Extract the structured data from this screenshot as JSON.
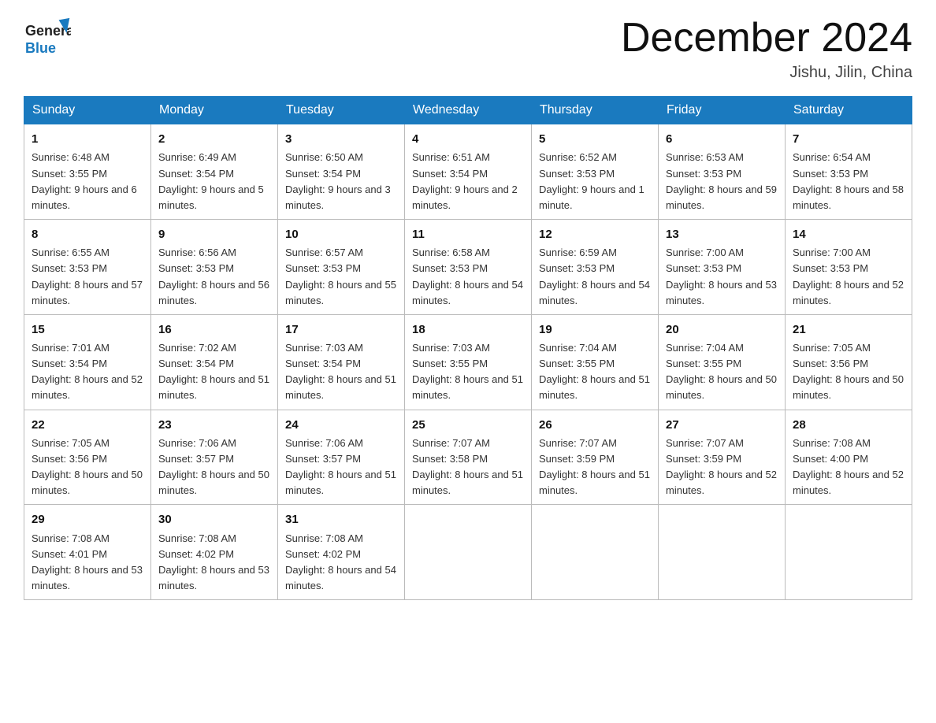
{
  "header": {
    "logo_text": "General Blue",
    "month_title": "December 2024",
    "location": "Jishu, Jilin, China"
  },
  "weekdays": [
    "Sunday",
    "Monday",
    "Tuesday",
    "Wednesday",
    "Thursday",
    "Friday",
    "Saturday"
  ],
  "weeks": [
    [
      {
        "day": "1",
        "sunrise": "6:48 AM",
        "sunset": "3:55 PM",
        "daylight": "9 hours and 6 minutes."
      },
      {
        "day": "2",
        "sunrise": "6:49 AM",
        "sunset": "3:54 PM",
        "daylight": "9 hours and 5 minutes."
      },
      {
        "day": "3",
        "sunrise": "6:50 AM",
        "sunset": "3:54 PM",
        "daylight": "9 hours and 3 minutes."
      },
      {
        "day": "4",
        "sunrise": "6:51 AM",
        "sunset": "3:54 PM",
        "daylight": "9 hours and 2 minutes."
      },
      {
        "day": "5",
        "sunrise": "6:52 AM",
        "sunset": "3:53 PM",
        "daylight": "9 hours and 1 minute."
      },
      {
        "day": "6",
        "sunrise": "6:53 AM",
        "sunset": "3:53 PM",
        "daylight": "8 hours and 59 minutes."
      },
      {
        "day": "7",
        "sunrise": "6:54 AM",
        "sunset": "3:53 PM",
        "daylight": "8 hours and 58 minutes."
      }
    ],
    [
      {
        "day": "8",
        "sunrise": "6:55 AM",
        "sunset": "3:53 PM",
        "daylight": "8 hours and 57 minutes."
      },
      {
        "day": "9",
        "sunrise": "6:56 AM",
        "sunset": "3:53 PM",
        "daylight": "8 hours and 56 minutes."
      },
      {
        "day": "10",
        "sunrise": "6:57 AM",
        "sunset": "3:53 PM",
        "daylight": "8 hours and 55 minutes."
      },
      {
        "day": "11",
        "sunrise": "6:58 AM",
        "sunset": "3:53 PM",
        "daylight": "8 hours and 54 minutes."
      },
      {
        "day": "12",
        "sunrise": "6:59 AM",
        "sunset": "3:53 PM",
        "daylight": "8 hours and 54 minutes."
      },
      {
        "day": "13",
        "sunrise": "7:00 AM",
        "sunset": "3:53 PM",
        "daylight": "8 hours and 53 minutes."
      },
      {
        "day": "14",
        "sunrise": "7:00 AM",
        "sunset": "3:53 PM",
        "daylight": "8 hours and 52 minutes."
      }
    ],
    [
      {
        "day": "15",
        "sunrise": "7:01 AM",
        "sunset": "3:54 PM",
        "daylight": "8 hours and 52 minutes."
      },
      {
        "day": "16",
        "sunrise": "7:02 AM",
        "sunset": "3:54 PM",
        "daylight": "8 hours and 51 minutes."
      },
      {
        "day": "17",
        "sunrise": "7:03 AM",
        "sunset": "3:54 PM",
        "daylight": "8 hours and 51 minutes."
      },
      {
        "day": "18",
        "sunrise": "7:03 AM",
        "sunset": "3:55 PM",
        "daylight": "8 hours and 51 minutes."
      },
      {
        "day": "19",
        "sunrise": "7:04 AM",
        "sunset": "3:55 PM",
        "daylight": "8 hours and 51 minutes."
      },
      {
        "day": "20",
        "sunrise": "7:04 AM",
        "sunset": "3:55 PM",
        "daylight": "8 hours and 50 minutes."
      },
      {
        "day": "21",
        "sunrise": "7:05 AM",
        "sunset": "3:56 PM",
        "daylight": "8 hours and 50 minutes."
      }
    ],
    [
      {
        "day": "22",
        "sunrise": "7:05 AM",
        "sunset": "3:56 PM",
        "daylight": "8 hours and 50 minutes."
      },
      {
        "day": "23",
        "sunrise": "7:06 AM",
        "sunset": "3:57 PM",
        "daylight": "8 hours and 50 minutes."
      },
      {
        "day": "24",
        "sunrise": "7:06 AM",
        "sunset": "3:57 PM",
        "daylight": "8 hours and 51 minutes."
      },
      {
        "day": "25",
        "sunrise": "7:07 AM",
        "sunset": "3:58 PM",
        "daylight": "8 hours and 51 minutes."
      },
      {
        "day": "26",
        "sunrise": "7:07 AM",
        "sunset": "3:59 PM",
        "daylight": "8 hours and 51 minutes."
      },
      {
        "day": "27",
        "sunrise": "7:07 AM",
        "sunset": "3:59 PM",
        "daylight": "8 hours and 52 minutes."
      },
      {
        "day": "28",
        "sunrise": "7:08 AM",
        "sunset": "4:00 PM",
        "daylight": "8 hours and 52 minutes."
      }
    ],
    [
      {
        "day": "29",
        "sunrise": "7:08 AM",
        "sunset": "4:01 PM",
        "daylight": "8 hours and 53 minutes."
      },
      {
        "day": "30",
        "sunrise": "7:08 AM",
        "sunset": "4:02 PM",
        "daylight": "8 hours and 53 minutes."
      },
      {
        "day": "31",
        "sunrise": "7:08 AM",
        "sunset": "4:02 PM",
        "daylight": "8 hours and 54 minutes."
      },
      null,
      null,
      null,
      null
    ]
  ]
}
